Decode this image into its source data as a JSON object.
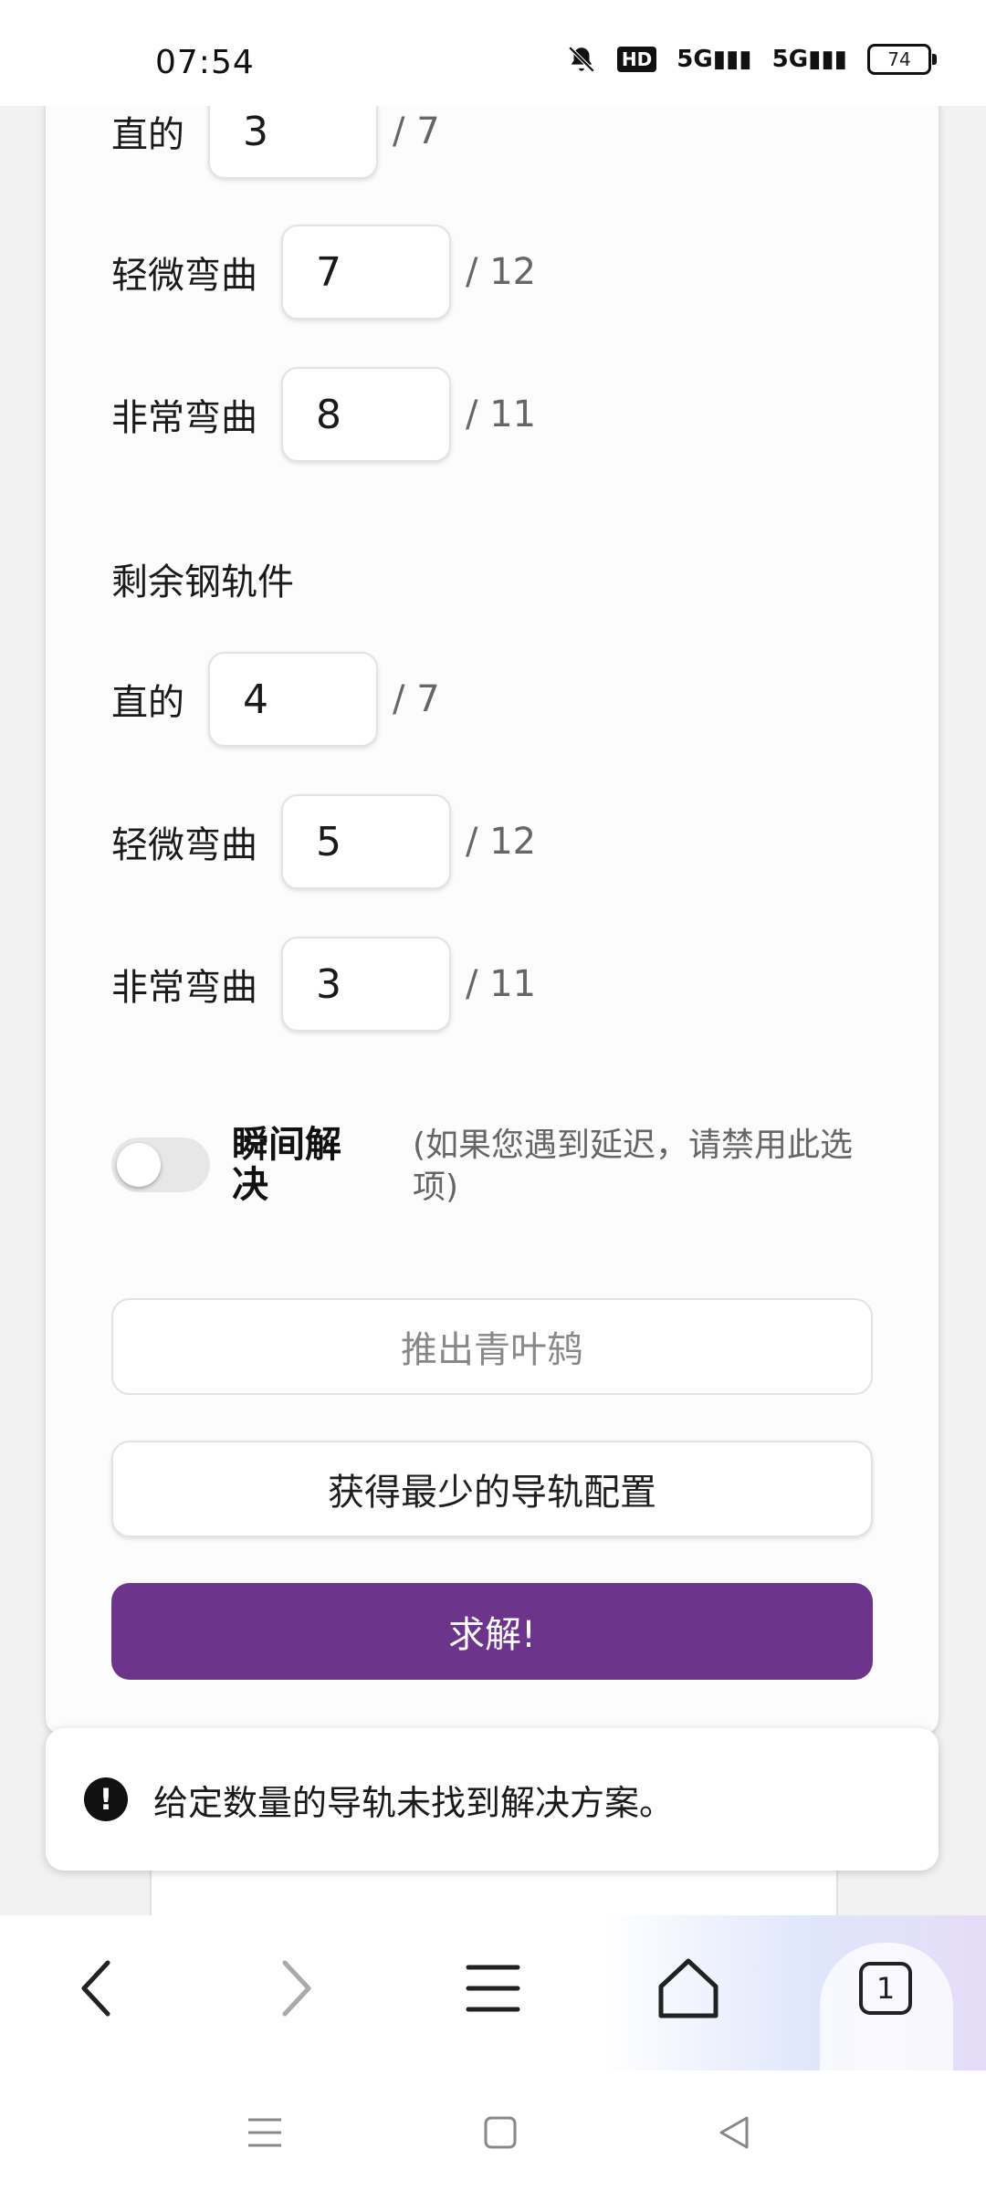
{
  "status_bar": {
    "time": "07:54",
    "hd_label": "HD",
    "signal1": "5G",
    "signal2": "5G",
    "battery": "74",
    "icons": [
      "mute-bell-icon",
      "hd-icon",
      "signal-5g-icon",
      "signal-5g-icon",
      "battery-icon"
    ]
  },
  "used_rails": [
    {
      "label": "直的",
      "value": "3",
      "max": "/ 7"
    },
    {
      "label": "轻微弯曲",
      "value": "7",
      "max": "/ 12"
    },
    {
      "label": "非常弯曲",
      "value": "8",
      "max": "/ 11"
    }
  ],
  "remaining": {
    "title": "剩余钢轨件",
    "rows": [
      {
        "label": "直的",
        "value": "4",
        "max": "/ 7"
      },
      {
        "label": "轻微弯曲",
        "value": "5",
        "max": "/ 12"
      },
      {
        "label": "非常弯曲",
        "value": "3",
        "max": "/ 11"
      }
    ]
  },
  "instant": {
    "label": "瞬间解决",
    "hint": "(如果您遇到延迟，请禁用此选项)",
    "enabled": false
  },
  "buttons": {
    "push": "推出青叶鸫",
    "min_config": "获得最少的导轨配置",
    "solve": "求解!"
  },
  "toast": {
    "message": "给定数量的导轨未找到解决方案。"
  },
  "browser": {
    "tab_count": "1"
  },
  "colors": {
    "accent": "#6d348b"
  }
}
